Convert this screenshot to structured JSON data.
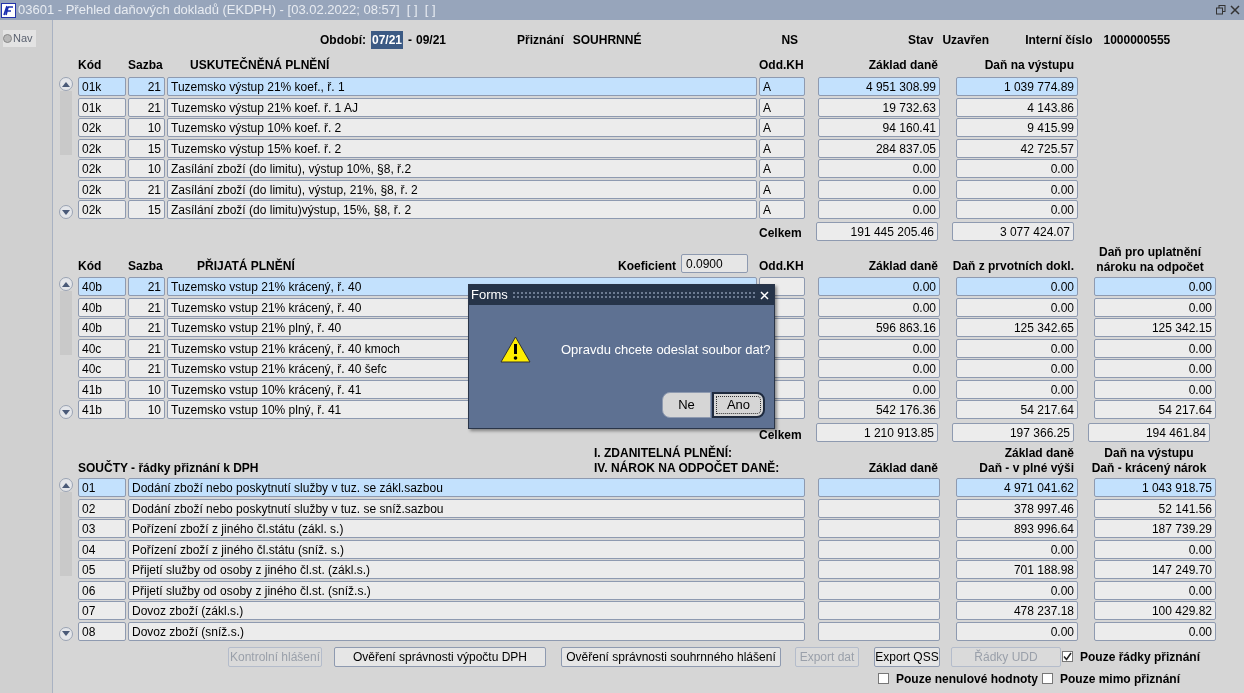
{
  "window": {
    "title": "03601 - Přehled daňových dokladů (EKDPH) - [03.02.2022; 08:57]  [ ]  [ ]"
  },
  "nav": {
    "label": "Nav"
  },
  "header": {
    "period_label": "Období:",
    "period_from": "07/21",
    "period_separator": "-",
    "period_to": "09/21",
    "return_label": "Přiznání",
    "return_value": "SOUHRNNÉ",
    "ns": "NS",
    "state_label": "Stav",
    "state_value": "Uzavřen",
    "internal_label": "Interní číslo",
    "internal_value": "1000000555"
  },
  "output_table": {
    "columns": [
      "Kód",
      "Sazba",
      "USKUTEČNĚNÁ PLNĚNÍ",
      "Odd.KH",
      "Základ daně",
      "Daň na výstupu"
    ],
    "rows": [
      {
        "code": "01k",
        "rate": "21",
        "description": "Tuzemsko výstup 21% koef., ř. 1",
        "odd_kh": "A",
        "base": "4 951 308.99",
        "tax": "1 039 774.89",
        "selected": true
      },
      {
        "code": "01k",
        "rate": "21",
        "description": "Tuzemsko výstup 21% koef. ř. 1 AJ",
        "odd_kh": "A",
        "base": "19 732.63",
        "tax": "4 143.86",
        "selected": false
      },
      {
        "code": "02k",
        "rate": "10",
        "description": "Tuzemsko výstup 10% koef. ř. 2",
        "odd_kh": "A",
        "base": "94 160.41",
        "tax": "9 415.99",
        "selected": false
      },
      {
        "code": "02k",
        "rate": "15",
        "description": "Tuzemsko výstup 15% koef. ř. 2",
        "odd_kh": "A",
        "base": "284 837.05",
        "tax": "42 725.57",
        "selected": false
      },
      {
        "code": "02k",
        "rate": "10",
        "description": "Zasílání zboží (do limitu), výstup 10%, §8, ř.2",
        "odd_kh": "A",
        "base": "0.00",
        "tax": "0.00",
        "selected": false
      },
      {
        "code": "02k",
        "rate": "21",
        "description": "Zasílání zboží (do limitu), výstup, 21%, §8, ř. 2",
        "odd_kh": "A",
        "base": "0.00",
        "tax": "0.00",
        "selected": false
      },
      {
        "code": "02k",
        "rate": "15",
        "description": "Zasílání zboží (do limitu)výstup, 15%, §8, ř. 2",
        "odd_kh": "A",
        "base": "0.00",
        "tax": "0.00",
        "selected": false
      }
    ],
    "total_label": "Celkem",
    "total_base": "191 445 205.46",
    "total_tax": "3 077 424.07"
  },
  "input_table": {
    "columns": [
      "Kód",
      "Sazba",
      "PŘIJATÁ PLNĚNÍ",
      "Odd.KH",
      "Základ daně",
      "Daň z prvotních dokl.",
      "Daň pro uplatnění nároku na odpočet"
    ],
    "coefficient_label": "Koeficient",
    "coefficient_value": "0.0900",
    "rows": [
      {
        "code": "40b",
        "rate": "21",
        "description": "Tuzemsko vstup 21% krácený, ř. 40",
        "base": "0.00",
        "tax_primary": "0.00",
        "tax_claim": "0.00",
        "selected": true
      },
      {
        "code": "40b",
        "rate": "21",
        "description": "Tuzemsko vstup 21% krácený, ř. 40",
        "base": "0.00",
        "tax_primary": "0.00",
        "tax_claim": "0.00",
        "selected": false
      },
      {
        "code": "40b",
        "rate": "21",
        "description": "Tuzemsko vstup 21% plný, ř. 40",
        "base": "596 863.16",
        "tax_primary": "125 342.65",
        "tax_claim": "125 342.15",
        "selected": false
      },
      {
        "code": "40c",
        "rate": "21",
        "description": "Tuzemsko vstup 21% krácený, ř. 40 kmoch",
        "base": "0.00",
        "tax_primary": "0.00",
        "tax_claim": "0.00",
        "selected": false
      },
      {
        "code": "40c",
        "rate": "21",
        "description": "Tuzemsko vstup 21% krácený, ř. 40 šefc",
        "base": "0.00",
        "tax_primary": "0.00",
        "tax_claim": "0.00",
        "selected": false
      },
      {
        "code": "41b",
        "rate": "10",
        "description": "Tuzemsko vstup 10% krácený, ř. 41",
        "base": "0.00",
        "tax_primary": "0.00",
        "tax_claim": "0.00",
        "selected": false
      },
      {
        "code": "41b",
        "rate": "10",
        "description": "Tuzemsko vstup 10% plný, ř. 41",
        "base": "542 176.36",
        "tax_primary": "54 217.64",
        "tax_claim": "54 217.64",
        "selected": false
      }
    ],
    "total_label": "Celkem",
    "total_base": "1 210 913.85",
    "total_tax_primary": "197 366.25",
    "total_tax_claim": "194 461.84"
  },
  "sums_table": {
    "title": "SOUČTY - řádky přiznání k DPH",
    "section_1": "I. ZDANITELNÁ PLNĚNÍ:",
    "section_4": "IV. NÁROK NA ODPOČET DANĚ:",
    "col_base": "Základ daně",
    "col_full_1": "Základ daně",
    "col_full_2": "Daň - v plné výši",
    "col_reduced_1": "Daň na výstupu",
    "col_reduced_2": "Daň - krácený nárok",
    "rows": [
      {
        "code": "01",
        "description": "Dodání zboží nebo poskytnutí služby v tuz. se zákl.sazbou",
        "full": "4 971 041.62",
        "reduced": "1 043 918.75",
        "selected": true
      },
      {
        "code": "02",
        "description": "Dodání zboží nebo poskytnutí služby v tuz. se sníž.sazbou",
        "full": "378 997.46",
        "reduced": "52 141.56",
        "selected": false
      },
      {
        "code": "03",
        "description": "Pořízení zboží z jiného čl.státu (zákl. s.)",
        "full": "893 996.64",
        "reduced": "187 739.29",
        "selected": false
      },
      {
        "code": "04",
        "description": "Pořízení zboží z jiného čl.státu (sníž. s.)",
        "full": "0.00",
        "reduced": "0.00",
        "selected": false
      },
      {
        "code": "05",
        "description": "Přijetí služby od osoby z jiného čl.st. (zákl.s.)",
        "full": "701 188.98",
        "reduced": "147 249.70",
        "selected": false
      },
      {
        "code": "06",
        "description": "Přijetí služby od osoby z jiného čl.st. (sníž.s.)",
        "full": "0.00",
        "reduced": "0.00",
        "selected": false
      },
      {
        "code": "07",
        "description": "Dovoz zboží (zákl.s.)",
        "full": "478 237.18",
        "reduced": "100 429.82",
        "selected": false
      },
      {
        "code": "08",
        "description": "Dovoz zboží (sníž.s.)",
        "full": "0.00",
        "reduced": "0.00",
        "selected": false
      }
    ]
  },
  "buttons": [
    {
      "label": "Kontrolní hlášení",
      "disabled": true
    },
    {
      "label": "Ověření správnosti výpočtu DPH",
      "disabled": false
    },
    {
      "label": "Ověření správnosti souhrnného hlášení",
      "disabled": false
    },
    {
      "label": "Export dat",
      "disabled": true
    },
    {
      "label": "Export QSS",
      "disabled": false
    },
    {
      "label": "Řádky UDD",
      "disabled": true
    }
  ],
  "checkboxes": [
    {
      "label": "Pouze řádky přiznání",
      "checked": true
    },
    {
      "label": "Pouze nenulové hodnoty",
      "checked": false
    },
    {
      "label": "Pouze mimo přiznání",
      "checked": false
    }
  ],
  "dialog": {
    "title": "Forms",
    "message": "Opravdu chcete odeslat soubor dat?",
    "buttons": [
      {
        "label": "Ne",
        "focused": false
      },
      {
        "label": "Ano",
        "focused": true
      }
    ]
  }
}
